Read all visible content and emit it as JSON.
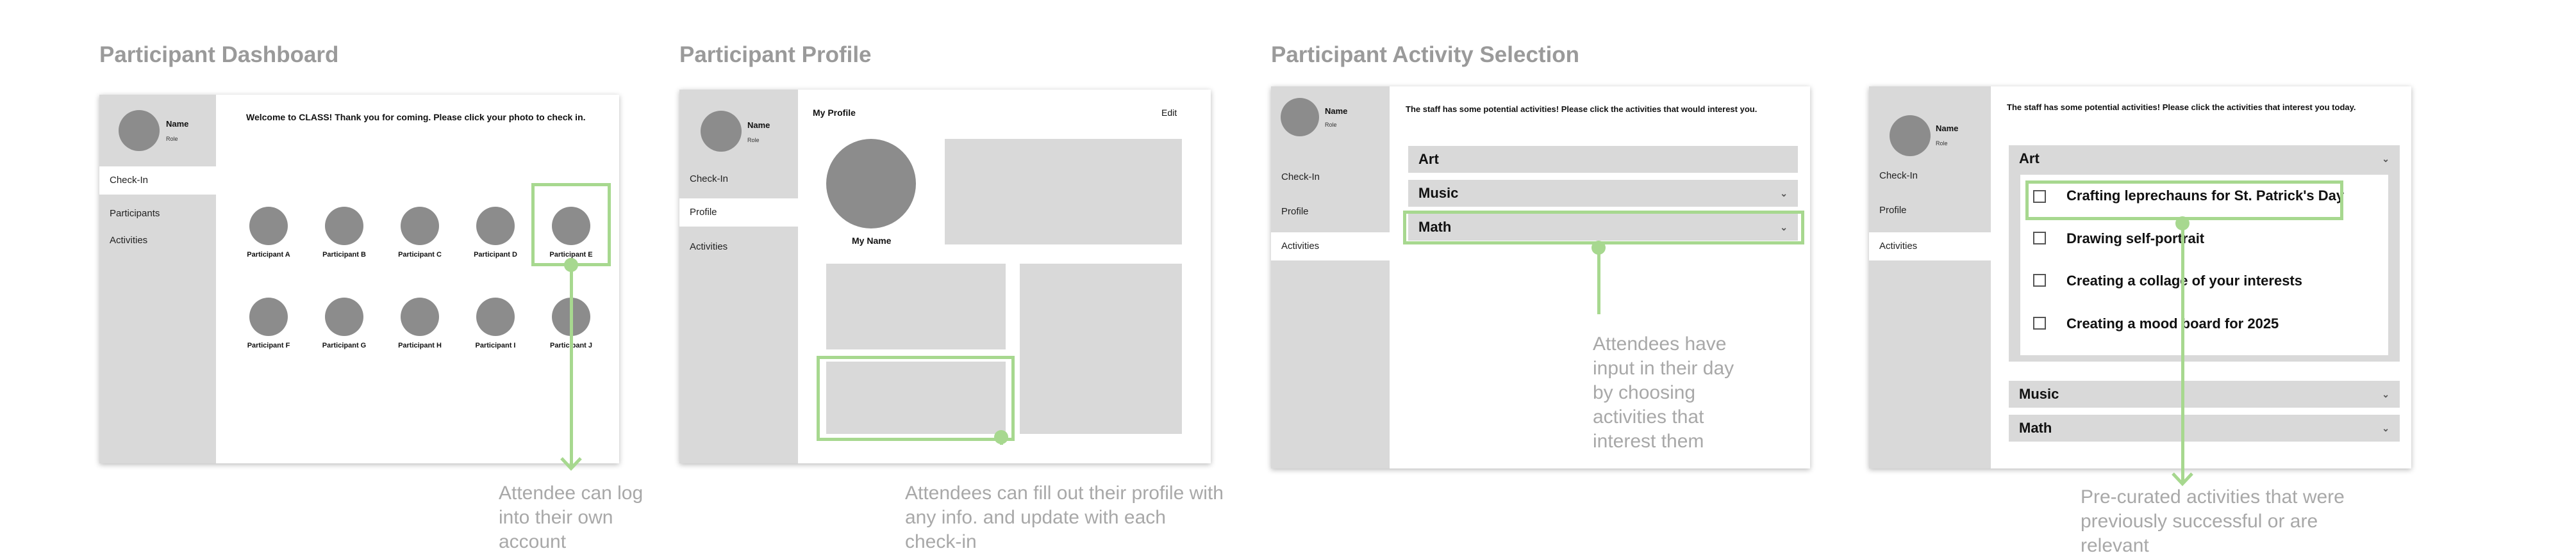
{
  "titles": {
    "dashboard": "Participant Dashboard",
    "profile": "Participant Profile",
    "activity": "Participant Activity Selection"
  },
  "user": {
    "name": "Name",
    "role": "Role"
  },
  "dashboard": {
    "nav": [
      "Check-In",
      "Participants",
      "Activities"
    ],
    "welcome": "Welcome to CLASS! Thank you for coming. Please click your photo to check in.",
    "participants": [
      "Participant A",
      "Participant B",
      "Participant C",
      "Participant D",
      "Participant E",
      "Participant F",
      "Participant G",
      "Participant H",
      "Participant I",
      "Participant J"
    ]
  },
  "profile": {
    "nav": [
      "Check-In",
      "Profile",
      "Activities"
    ],
    "heading": "My Profile",
    "edit": "Edit",
    "my_name": "My Name"
  },
  "activity1": {
    "nav": [
      "Check-In",
      "Profile",
      "Activities"
    ],
    "prompt": "The staff has some potential activities! Please click the activities that would interest you.",
    "categories": [
      "Art",
      "Music",
      "Math"
    ]
  },
  "activity2": {
    "nav": [
      "Check-In",
      "Profile",
      "Activities"
    ],
    "prompt": "The staff has some potential activities! Please click the activities that interest you today.",
    "categories": [
      "Art",
      "Music",
      "Math"
    ],
    "art_items": [
      "Crafting leprechauns for St. Patrick's Day",
      "Drawing self-portrait",
      "Creating a collage of your interests",
      "Creating a mood board for 2025"
    ]
  },
  "notes": {
    "dashboard": "Attendee can log into their own account",
    "profile": "Attendees can fill out their profile with any info. and update with each check-in",
    "activity": "Attendees have input in their day by choosing activities that interest them",
    "curated": "Pre-curated activities that were previously successful or are relevant"
  },
  "icons": {
    "chevron": "chevron-down-icon",
    "checkbox": "checkbox-icon"
  },
  "colors": {
    "highlight": "#a7d88f",
    "sidebar": "#d9d9d9",
    "title": "#9a9a9a",
    "avatar": "#8c8c8c"
  }
}
